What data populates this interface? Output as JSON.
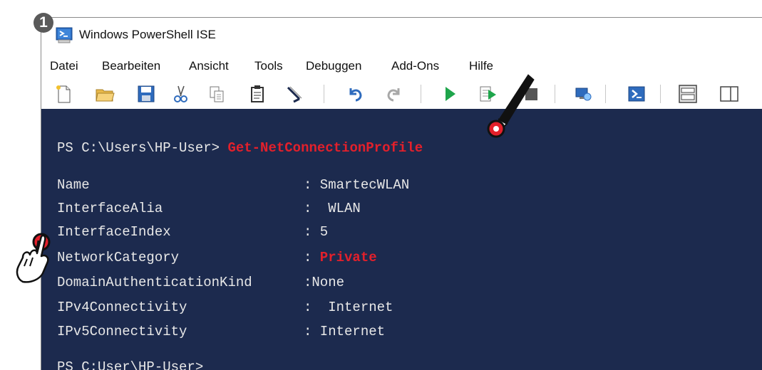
{
  "step_badge": "1",
  "window": {
    "title": "Windows PowerShell ISE"
  },
  "menu": [
    "Datei",
    "Bearbeiten",
    "Ansicht",
    "Tools",
    "Debuggen",
    "Add-Ons",
    "Hilfe"
  ],
  "toolbar": {
    "icons": [
      "new-file-icon",
      "open-folder-icon",
      "save-icon",
      "cut-icon",
      "copy-icon",
      "paste-icon",
      "clear-console-icon",
      "undo-icon",
      "redo-icon",
      "run-icon",
      "run-selection-icon",
      "stop-icon",
      "remote-powershell-icon",
      "powershell-console-icon",
      "layout-top-icon",
      "layout-right-icon"
    ]
  },
  "console": {
    "prompt1": "PS C:\\Users\\HP-User> ",
    "command": "Get-NetConnectionProfile",
    "properties": [
      {
        "name": "Name",
        "colon": ":",
        "value": " SmartecWLAN",
        "highlight": false
      },
      {
        "name": "InterfaceAlia",
        "colon": ":",
        "value": "  WLAN",
        "highlight": false
      },
      {
        "name": "InterfaceIndex",
        "colon": ":",
        "value": " 5",
        "highlight": false
      },
      {
        "name": "NetworkCategory",
        "colon": ":",
        "value": " Private",
        "highlight": true
      },
      {
        "name": "DomainAuthenticationKind",
        "colon": ":",
        "value": "None",
        "highlight": false
      },
      {
        "name": "IPv4Connectivity",
        "colon": ":",
        "value": "  Internet",
        "highlight": false
      },
      {
        "name": "IPv5Connectivity",
        "colon": ":",
        "value": " Internet",
        "highlight": false
      }
    ],
    "prompt2": "PS C:User\\HP-User>"
  },
  "colors": {
    "console_bg": "#1c2a4e",
    "highlight": "#e3202b"
  }
}
